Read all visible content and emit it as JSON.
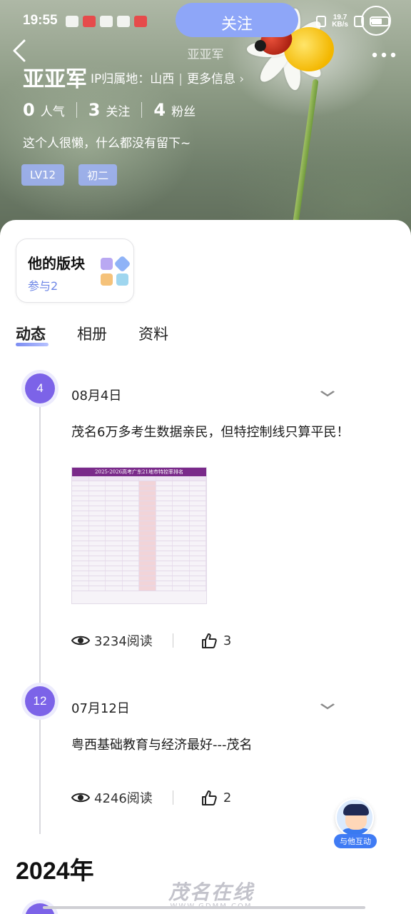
{
  "status_bar": {
    "time": "19:55",
    "net_speed_value": "19.7",
    "net_speed_unit": "KB/s"
  },
  "header": {
    "follow_label": "关注",
    "nav_title": "亚亚军",
    "user_name": "亚亚军",
    "ip_label": "IP归属地：山西",
    "more_info": "更多信息",
    "stats": [
      {
        "num": "0",
        "label": "人气"
      },
      {
        "num": "3",
        "label": "关注"
      },
      {
        "num": "4",
        "label": "粉丝"
      }
    ],
    "bio": "这个人很懒，什么都没有留下~",
    "tags": [
      "LV12",
      "初二"
    ]
  },
  "board": {
    "title": "他的版块",
    "subtitle": "参与2"
  },
  "tabs": [
    "动态",
    "相册",
    "资料"
  ],
  "posts": [
    {
      "day": "4",
      "date": "08月4日",
      "text": "茂名6万多考生数据亲民，但特控制线只算平民！",
      "image_title": "2025-2026高考广东21地市特控率排名",
      "views": "3234阅读",
      "likes": "3"
    },
    {
      "day": "12",
      "date": "07月12日",
      "text": "粤西基础教育与经济最好---茂名",
      "views": "4246阅读",
      "likes": "2"
    }
  ],
  "year_heading": "2024年",
  "float_button": {
    "label": "与他互动"
  },
  "watermark": {
    "main": "茂名在线",
    "sub": "WWW.GDMM.COM"
  },
  "colors": {
    "accent": "#7c63e8",
    "follow_button": "#8ea6f8",
    "tag_bg": "#a0b4fa",
    "interact_blue": "#3f7bf4"
  }
}
